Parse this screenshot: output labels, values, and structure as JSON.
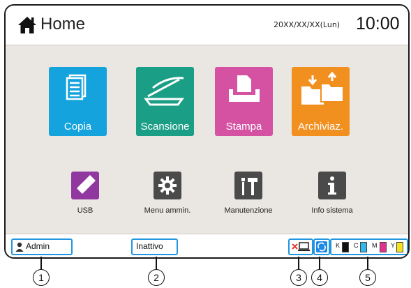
{
  "header": {
    "title": "Home",
    "date": "20XX/XX/XX(Lun)",
    "time": "10:00"
  },
  "main_buttons": [
    {
      "label": "Copia",
      "color": "#15a3dd",
      "icon": "copy-document-icon"
    },
    {
      "label": "Scansione",
      "color": "#1a9e86",
      "icon": "scanner-icon"
    },
    {
      "label": "Stampa",
      "color": "#d552a2",
      "icon": "print-tray-icon"
    },
    {
      "label": "Archiviaz.",
      "color": "#f1901f",
      "icon": "storage-folder-icon"
    }
  ],
  "utility_buttons": [
    {
      "label": "USB",
      "color": "#9038a0",
      "icon": "usb-stick-icon"
    },
    {
      "label": "Menu ammin.",
      "color": "#4a4a4a",
      "icon": "gear-icon"
    },
    {
      "label": "Manutenzione",
      "color": "#4a4a4a",
      "icon": "tools-icon"
    },
    {
      "label": "Info sistema",
      "color": "#4a4a4a",
      "icon": "info-icon"
    }
  ],
  "status_bar": {
    "user": "Admin",
    "state": "Inattivo",
    "network_icon": "network-disconnected-icon",
    "sync_icon": "sync-icon",
    "inks": [
      {
        "label": "K",
        "color": "#111111"
      },
      {
        "label": "C",
        "color": "#33b6ea"
      },
      {
        "label": "M",
        "color": "#e0338f"
      },
      {
        "label": "Y",
        "color": "#f4e21c"
      }
    ]
  },
  "callouts": [
    "1",
    "2",
    "3",
    "4",
    "5"
  ]
}
